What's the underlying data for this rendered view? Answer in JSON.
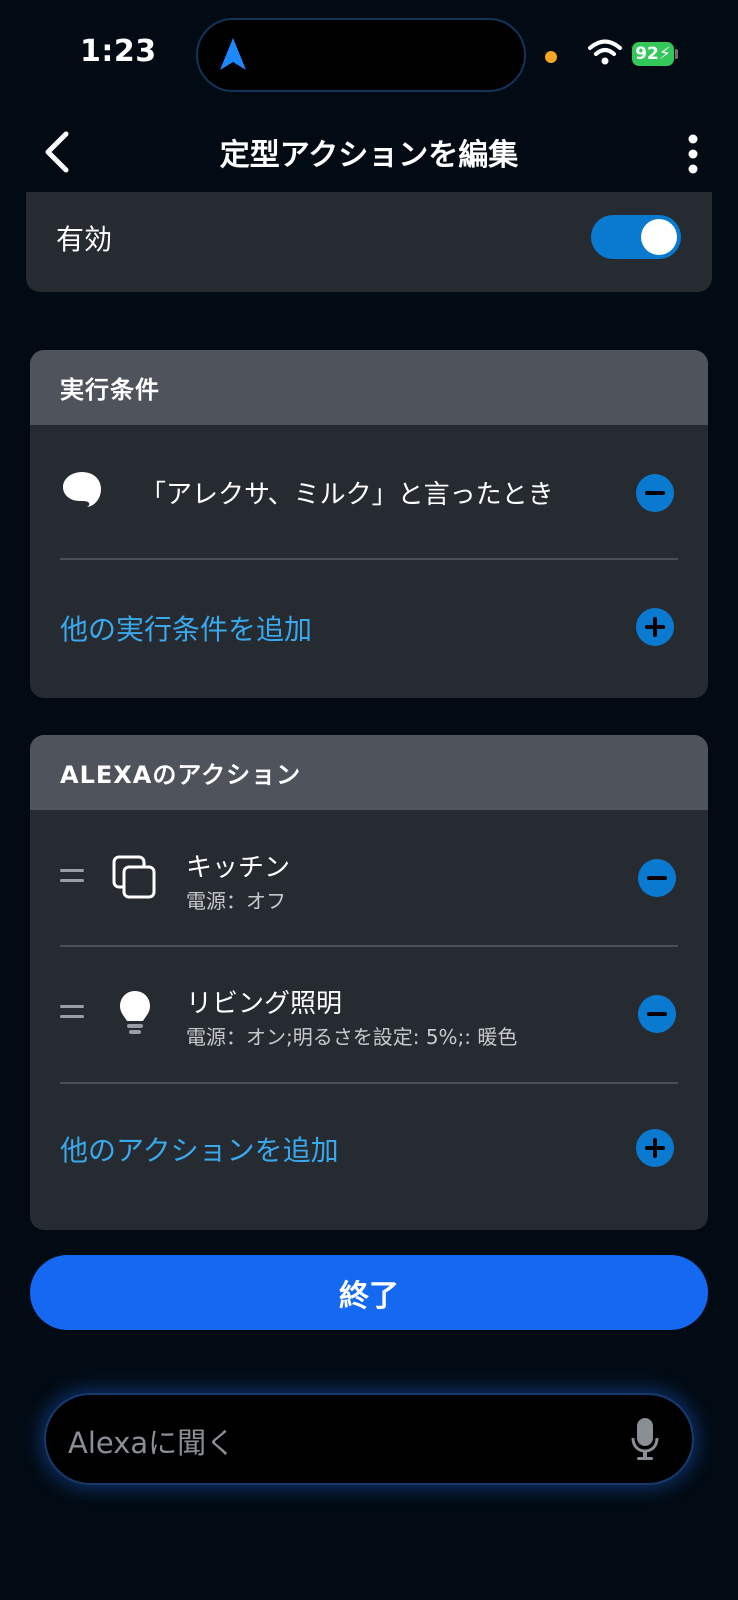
{
  "status": {
    "time": "1:23",
    "battery": "92"
  },
  "header": {
    "title": "定型アクションを編集"
  },
  "enabled": {
    "label": "有効",
    "on": true
  },
  "conditions": {
    "heading": "実行条件",
    "items": [
      {
        "icon": "speech-bubble-icon",
        "text": "「アレクサ、ミルク」と言ったとき"
      }
    ],
    "add_label": "他の実行条件を追加"
  },
  "actions": {
    "heading": "ALEXAのアクション",
    "items": [
      {
        "icon": "device-group-icon",
        "title": "キッチン",
        "detail": "電源：オフ"
      },
      {
        "icon": "light-bulb-icon",
        "title": "リビング照明",
        "detail": "電源：オン;明るさを設定: 5%;: 暖色"
      }
    ],
    "add_label": "他のアクションを追加"
  },
  "done_button": "終了",
  "ask_bar": {
    "placeholder": "Alexaに聞く"
  },
  "colors": {
    "accent": "#0a7ad0",
    "link": "#3aa8ec",
    "button": "#1568f0",
    "card": "#262a31"
  }
}
